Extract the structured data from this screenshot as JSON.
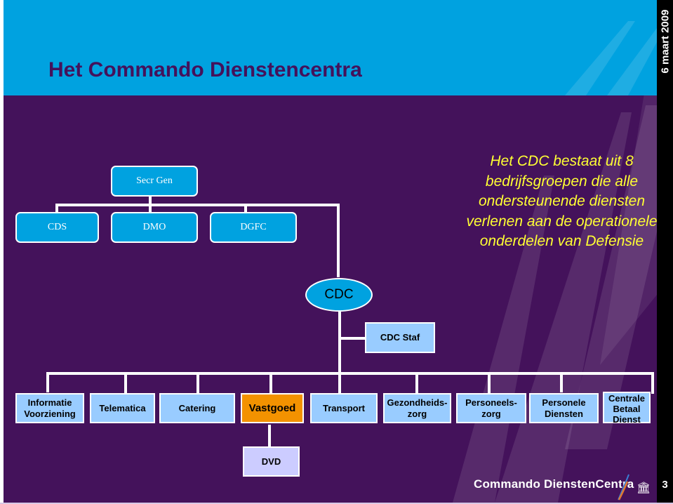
{
  "slide": {
    "title": "Het Commando Dienstencentra",
    "date": "6 maart 2009",
    "page_number": "3",
    "colors": {
      "header_bg": "#00a2e0",
      "body_bg": "#44125b",
      "title_text": "#44125b",
      "quote_text": "#ffff33",
      "unit_box": "#99ccff",
      "highlight_box": "#f39200",
      "sub_box": "#ccccff",
      "connector": "#ffffff"
    }
  },
  "org_chart": {
    "top": {
      "secr_gen": "Secr Gen",
      "peers": [
        "CDS",
        "DMO",
        "DGFC"
      ]
    },
    "cdc": "CDC",
    "staff": "CDC Staf",
    "units": [
      {
        "label": "Informatie\nVoorziening",
        "highlight": false
      },
      {
        "label": "Telematica",
        "highlight": false
      },
      {
        "label": "Catering",
        "highlight": false
      },
      {
        "label": "Vastgoed",
        "highlight": true
      },
      {
        "label": "Transport",
        "highlight": false
      },
      {
        "label": "Gezondheids-\nzorg",
        "highlight": false
      },
      {
        "label": "Personeels-\nzorg",
        "highlight": false
      },
      {
        "label": "Personele\nDiensten",
        "highlight": false
      },
      {
        "label": "Centrale\nBetaal\nDienst",
        "highlight": false
      }
    ],
    "sub_unit": {
      "label": "DVD",
      "parent": "Vastgoed"
    }
  },
  "quote": "Het CDC bestaat uit 8 bedrijfsgroepen die alle ondersteunende diensten verlenen aan de operationele onderdelen van Defensie",
  "footer": {
    "logo_text": "Commando DienstenCentra",
    "logo_icons": [
      "feather-icon",
      "column-icon"
    ]
  }
}
